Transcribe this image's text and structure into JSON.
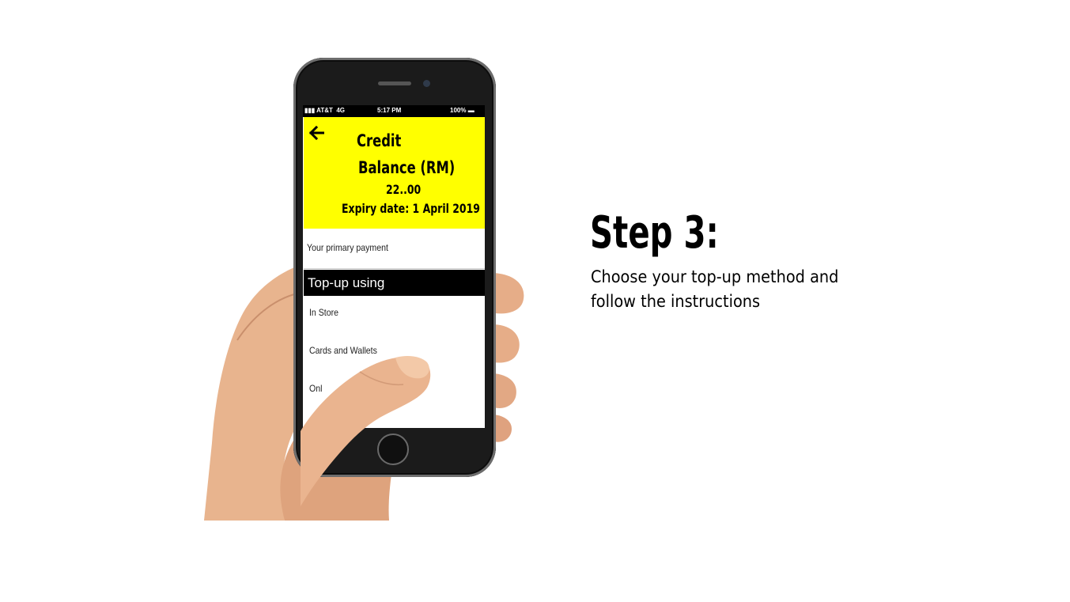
{
  "phone": {
    "status_bar": {
      "carrier": "AT&T",
      "network": "4G",
      "time": "5:17 PM",
      "battery": "100%"
    },
    "header": {
      "title_line1": "Credit",
      "title_line2": "Balance (RM)",
      "amount": "22..00",
      "expiry": "Expiry date: 1 April 2019",
      "background_color": "#ffff00",
      "back_icon": "arrow-left-icon"
    },
    "primary_payment": "Your primary payment",
    "section_label": "Top-up using",
    "options": [
      {
        "label": "In Store"
      },
      {
        "label": "Cards and Wallets"
      },
      {
        "label": "Onl"
      }
    ]
  },
  "instructions": {
    "step_title": "Step 3:",
    "line1": "Choose your top-up method and",
    "line2": "follow the instructions"
  }
}
